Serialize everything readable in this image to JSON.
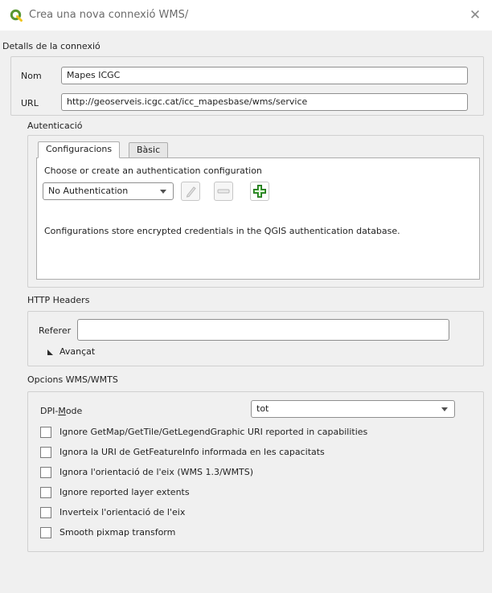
{
  "window": {
    "title": "Crea una nova connexió WMS/",
    "close_glyph": "✕",
    "app_icon": "qgis-logo-icon"
  },
  "connection": {
    "group_title": "Detalls de la connexió",
    "name_label": "Nom",
    "name_value": "Mapes ICGC",
    "url_label": "URL",
    "url_value": "http://geoserveis.icgc.cat/icc_mapesbase/wms/service"
  },
  "auth": {
    "section_title": "Autenticació",
    "tabs": [
      "Configuracions",
      "Bàsic"
    ],
    "active_tab": "Configuracions",
    "choose_text": "Choose or create an authentication configuration",
    "selected_config": "No Authentication",
    "edit_icon": "pencil-icon",
    "remove_icon": "minus-icon",
    "add_icon": "green-plus-icon",
    "info_text": "Configurations store encrypted credentials in the QGIS authentication database."
  },
  "http_headers": {
    "section_title": "HTTP Headers",
    "referer_label": "Referer",
    "referer_value": "",
    "advanced_label": "Avançat",
    "advanced_icon": "triangle-right-icon"
  },
  "wms_options": {
    "section_title": "Opcions WMS/WMTS",
    "dpi_label_prefix": "DPI-",
    "dpi_label_mnemonic": "M",
    "dpi_label_suffix": "ode",
    "dpi_value": "tot",
    "checkboxes": [
      {
        "label": "Ignore GetMap/GetTile/GetLegendGraphic URI reported in capabilities",
        "checked": false
      },
      {
        "label": "Ignora la URI de GetFeatureInfo informada en les capacitats",
        "checked": false
      },
      {
        "label": "Ignora l'orientació de l'eix (WMS 1.3/WMTS)",
        "checked": false
      },
      {
        "label": "Ignore reported layer extents",
        "checked": false
      },
      {
        "label": "Inverteix l'orientació de l'eix",
        "checked": false
      },
      {
        "label": "Smooth pixmap transform",
        "checked": false
      }
    ]
  },
  "colors": {
    "qgis_green": "#589632",
    "qgis_yellow": "#f0c419",
    "plus_green": "#3fa535"
  }
}
